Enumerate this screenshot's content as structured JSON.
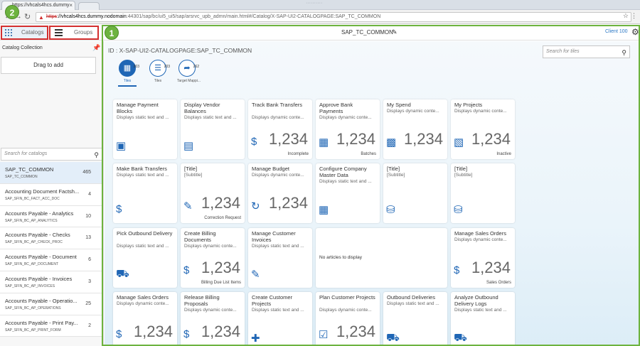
{
  "browser": {
    "tab_title": "https://vhcals4hcs.dummy",
    "tab_close": "×",
    "window_title": "··········",
    "url_scheme": "https",
    "url_host": "://vhcals4hcs.dummy.nodomain",
    "url_path": ":44301/sap/bc/ui5_ui5/sap/arsrvc_upb_admn/main.html#/Catalog/X-SAP-UI2-CATALOGPAGE:SAP_TC_COMMON"
  },
  "shell": {
    "catalogs_label": "Catalogs",
    "groups_label": "Groups",
    "title": "SAP_TC_COMMON",
    "client": "Client  100"
  },
  "badges": {
    "one": "1",
    "two": "2"
  },
  "left": {
    "title": "Catalog Collection",
    "drag_label": "Drag to add",
    "search_placeholder": "Search for catalogs",
    "catalogs": [
      {
        "name": "SAP_TC_COMMON",
        "id": "SAP_TC_COMMON",
        "count": "465",
        "selected": true
      },
      {
        "name": "Accounting Document Factsh...",
        "id": "SAP_SFIN_BC_FACT_ACC_DOC",
        "count": "4"
      },
      {
        "name": "Accounts Payable - Analytics",
        "id": "SAP_SFIN_BC_AP_ANALYTICS",
        "count": "10"
      },
      {
        "name": "Accounts Payable - Checks",
        "id": "SAP_SFIN_BC_AP_CHECK_PROC",
        "count": "13"
      },
      {
        "name": "Accounts Payable - Document",
        "id": "SAP_SFIN_BC_AP_DOCUMENT",
        "count": "6"
      },
      {
        "name": "Accounts Payable - Invoices",
        "id": "SAP_SFIN_BC_AP_INVOICES",
        "count": "3"
      },
      {
        "name": "Accounts Payable - Operatio...",
        "id": "SAP_SFIN_BC_AP_OPERATIONS",
        "count": "25"
      },
      {
        "name": "Accounts Payable - Print Pay...",
        "id": "SAP_SFIN_BC_AP_PRINT_FORM",
        "count": "2"
      }
    ]
  },
  "main": {
    "catalog_id": "ID : X-SAP-UI2-CATALOGPAGE:SAP_TC_COMMON",
    "search_placeholder": "Search for tiles",
    "segments": [
      {
        "label": "Tiles",
        "count": "203",
        "icon": "grid-icon"
      },
      {
        "label": "Tiles",
        "count": "203",
        "icon": "list-icon"
      },
      {
        "label": "Target Mappi...",
        "count": "262",
        "icon": "share-icon"
      }
    ],
    "tiles": [
      {
        "title": "Manage Payment Blocks",
        "sub": "Displays static text and ...",
        "icon": "payment-block-icon"
      },
      {
        "title": "Display Vendor Balances",
        "sub": "Displays static text and ...",
        "icon": "monitor-dollar-icon"
      },
      {
        "title": "Track Bank Transfers",
        "sub": "Displays dynamic conte...",
        "num": "1,234",
        "foot": "Incomplete",
        "icon": "dollar-arrow-icon"
      },
      {
        "title": "Approve Bank Payments",
        "sub": "Displays dynamic conte...",
        "num": "1,234",
        "foot": "Batches",
        "icon": "bank-doc-icon"
      },
      {
        "title": "My Spend",
        "sub": "Displays dynamic conte...",
        "num": "1,234",
        "icon": "dashboard-icon"
      },
      {
        "title": "My Projects",
        "sub": "Displays dynamic conte...",
        "num": "1,234",
        "foot": "Inactive",
        "icon": "project-card-icon"
      },
      {
        "title": "Make Bank Transfers",
        "sub": "Displays static text and ...",
        "icon": "dollar-plus-icon"
      },
      {
        "title": "[Title]",
        "sub": "[Subtitle]",
        "num": "1,234",
        "foot": "Correction Request",
        "icon": "edit-doc-icon"
      },
      {
        "title": "Manage Budget",
        "sub": "Displays dynamic conte...",
        "num": "1,234",
        "icon": "budget-cycle-icon"
      },
      {
        "title": "Configure Company Master Data",
        "sub": "Displays static text and ...",
        "icon": "building-gear-icon"
      },
      {
        "title": "[Title]",
        "sub": "[Subtitle]",
        "icon": "database-gear-icon"
      },
      {
        "title": "[Title]",
        "sub": "[Subtitle]",
        "icon": "database-gear-icon"
      },
      {
        "title": "Pick Outbound Delivery",
        "sub": "Displays static text and ...",
        "icon": "truck-check-icon"
      },
      {
        "title": "Create Billing Documents",
        "sub": "Displays dynamic conte...",
        "num": "1,234",
        "foot": "Billing Due List Items",
        "icon": "doc-dollar-plus-icon"
      },
      {
        "title": "Manage Customer Invoices",
        "sub": "Displays static text and ...",
        "icon": "invoice-edit-icon"
      },
      {
        "title": "",
        "sub": "No articles to display",
        "wide": true
      },
      {
        "title": "Manage Sales Orders",
        "sub": "Displays dynamic conte...",
        "num": "1,234",
        "foot": "Sales Orders",
        "icon": "sales-order-icon"
      },
      {
        "title": "Manage Sales Orders",
        "sub": "Displays dynamic conte...",
        "num": "1,234",
        "icon": "sales-order-icon"
      },
      {
        "title": "Release Billing Proposals",
        "sub": "Displays dynamic conte...",
        "num": "1,234",
        "icon": "doc-dollar-icon"
      },
      {
        "title": "Create Customer Projects",
        "sub": "Displays static text and ...",
        "icon": "plus-icon"
      },
      {
        "title": "Plan Customer Projects",
        "sub": "Displays dynamic conte...",
        "num": "1,234",
        "icon": "checklist-icon"
      },
      {
        "title": "Outbound Deliveries",
        "sub": "Displays static text and ...",
        "icon": "truck-list-icon"
      },
      {
        "title": "Analyze Outbound Delivery Logs",
        "sub": "Displays static text and ...",
        "icon": "truck-search-icon"
      }
    ]
  }
}
